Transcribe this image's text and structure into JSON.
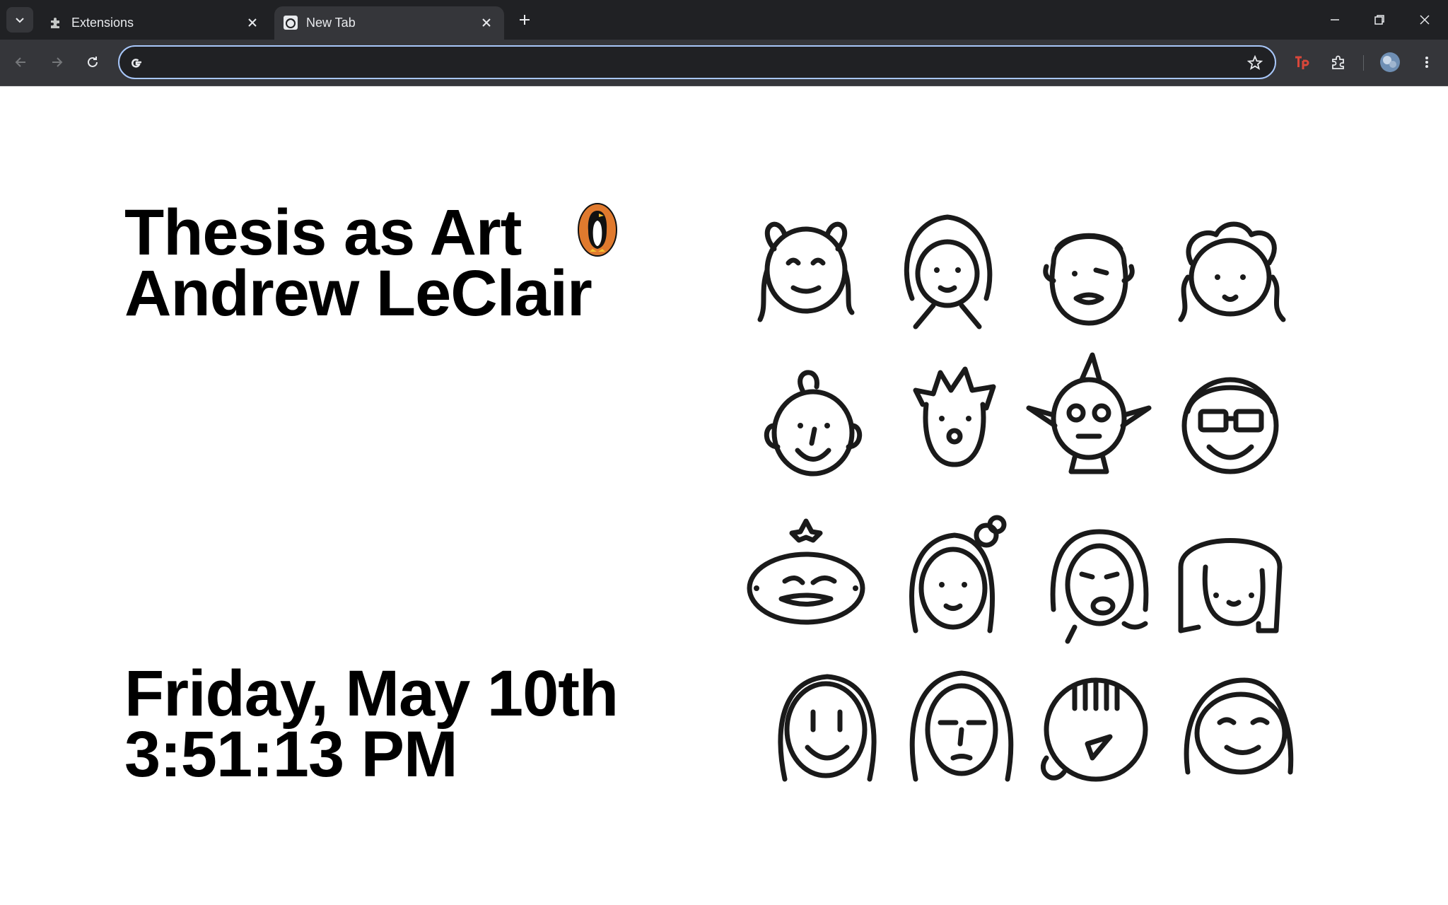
{
  "browser": {
    "tabs": [
      {
        "title": "Extensions",
        "icon": "puzzle-icon",
        "active": false
      },
      {
        "title": "New Tab",
        "icon": "newtab-favicon",
        "active": true
      }
    ],
    "omnibox": {
      "value": "",
      "placeholder": ""
    },
    "extensions": [
      "tp-extension-icon",
      "puzzle-icon",
      "profile-avatar"
    ]
  },
  "page": {
    "title_line1": "Thesis as Art",
    "title_line2": "Andrew LeClair",
    "date": "Friday, May 10th",
    "time": "3:51:13 PM",
    "logo": "penguin-logo",
    "faces_count": 16
  },
  "colors": {
    "tabstrip": "#202124",
    "toolbar": "#35363a",
    "omnibox_border": "#a8c7fa",
    "text_dark": "#000000",
    "penguin_orange": "#e07a2e"
  }
}
